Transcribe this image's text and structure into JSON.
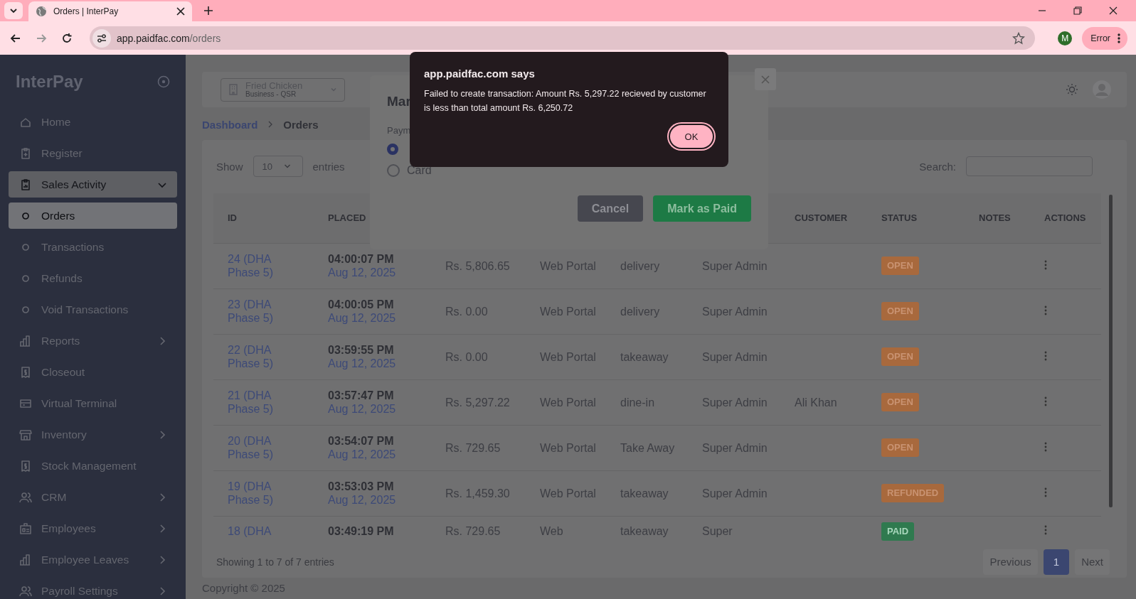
{
  "browser": {
    "tab_title": "Orders | InterPay",
    "url_host": "app.paidfac.com",
    "url_path": "/orders",
    "profile_initial": "M",
    "error_label": "Error"
  },
  "sidebar": {
    "brand": "InterPay",
    "items": [
      {
        "label": "Home",
        "kind": "nav",
        "selected": false
      },
      {
        "label": "Register",
        "kind": "nav",
        "selected": false
      },
      {
        "label": "Sales Activity",
        "kind": "group",
        "selected": false,
        "expanded": true
      },
      {
        "label": "Orders",
        "kind": "sub",
        "selected": true
      },
      {
        "label": "Transactions",
        "kind": "sub",
        "selected": false
      },
      {
        "label": "Refunds",
        "kind": "sub",
        "selected": false
      },
      {
        "label": "Void Transactions",
        "kind": "sub",
        "selected": false
      },
      {
        "label": "Reports",
        "kind": "group",
        "selected": false,
        "expanded": false
      },
      {
        "label": "Closeout",
        "kind": "nav",
        "selected": false
      },
      {
        "label": "Virtual Terminal",
        "kind": "nav",
        "selected": false
      },
      {
        "label": "Inventory",
        "kind": "group",
        "selected": false,
        "expanded": false
      },
      {
        "label": "Stock Management",
        "kind": "nav",
        "selected": false
      },
      {
        "label": "CRM",
        "kind": "group",
        "selected": false,
        "expanded": false
      },
      {
        "label": "Employees",
        "kind": "group",
        "selected": false,
        "expanded": false
      },
      {
        "label": "Employee Leaves",
        "kind": "group",
        "selected": false,
        "expanded": false
      },
      {
        "label": "Payroll Settings",
        "kind": "group",
        "selected": false,
        "expanded": false
      }
    ]
  },
  "topbar": {
    "business_name": "Fried Chicken",
    "business_type": "Business - QSR"
  },
  "breadcrumb": [
    "Dashboard",
    "Orders"
  ],
  "table_controls": {
    "show_label": "Show",
    "page_size": "10",
    "entries_label": "entries",
    "search_label": "Search:"
  },
  "table": {
    "columns": [
      "ID",
      "PLACED",
      "",
      "",
      "",
      "",
      "CUSTOMER",
      "STATUS",
      "NOTES",
      "ACTIONS"
    ],
    "rows": [
      {
        "id": "24 (DHA Phase 5)",
        "time": "04:00:07 PM",
        "date": "Aug 12, 2025",
        "amount": "Rs. 5,806.65",
        "source": "Web Portal",
        "type": "delivery",
        "by": "Super Admin",
        "customer": "",
        "status": "OPEN",
        "color": "#a8693d"
      },
      {
        "id": "23 (DHA Phase 5)",
        "time": "04:00:05 PM",
        "date": "Aug 12, 2025",
        "amount": "Rs. 0.00",
        "source": "Web Portal",
        "type": "delivery",
        "by": "Super Admin",
        "customer": "",
        "status": "OPEN",
        "color": "#a8693d"
      },
      {
        "id": "22 (DHA Phase 5)",
        "time": "03:59:55 PM",
        "date": "Aug 12, 2025",
        "amount": "Rs. 0.00",
        "source": "Web Portal",
        "type": "takeaway",
        "by": "Super Admin",
        "customer": "",
        "status": "OPEN",
        "color": "#a8693d"
      },
      {
        "id": "21 (DHA Phase 5)",
        "time": "03:57:47 PM",
        "date": "Aug 12, 2025",
        "amount": "Rs. 5,297.22",
        "source": "Web Portal",
        "type": "dine-in",
        "by": "Super Admin",
        "customer": "Ali Khan",
        "status": "OPEN",
        "color": "#a8693d"
      },
      {
        "id": "20 (DHA Phase 5)",
        "time": "03:54:07 PM",
        "date": "Aug 12, 2025",
        "amount": "Rs. 729.65",
        "source": "Web Portal",
        "type": "Take Away",
        "by": "Super Admin",
        "customer": "",
        "status": "OPEN",
        "color": "#a8693d"
      },
      {
        "id": "19 (DHA Phase 5)",
        "time": "03:53:03 PM",
        "date": "Aug 12, 2025",
        "amount": "Rs. 1,459.30",
        "source": "Web Portal",
        "type": "takeaway",
        "by": "Super Admin",
        "customer": "",
        "status": "REFUNDED",
        "color": "#a8693d"
      },
      {
        "id": "18 (DHA",
        "time": "03:49:19 PM",
        "amount": "Rs. 729.65",
        "source": "Web",
        "type": "takeaway",
        "by": "Super",
        "customer": "",
        "status": "PAID",
        "color": "#2f7a4f"
      }
    ]
  },
  "table_footer": {
    "info": "Showing 1 to 7 of 7 entries",
    "pages": [
      {
        "label": "Previous",
        "selected": false,
        "disabled": true
      },
      {
        "label": "1",
        "selected": true,
        "disabled": false
      },
      {
        "label": "Next",
        "selected": false,
        "disabled": true
      }
    ]
  },
  "copyright": "Copyright © 2025",
  "modal": {
    "title": "Mar",
    "payment_label": "Paym",
    "options": [
      {
        "selected": true
      },
      {
        "label": "Card",
        "selected": false
      }
    ],
    "cancel": "Cancel",
    "confirm": "Mark as Paid"
  },
  "alert": {
    "title": "app.paidfac.com says",
    "message": "Failed to create transaction: Amount Rs. 5,297.22 recieved by customer is less than total amount Rs. 6,250.72",
    "ok": "OK"
  }
}
